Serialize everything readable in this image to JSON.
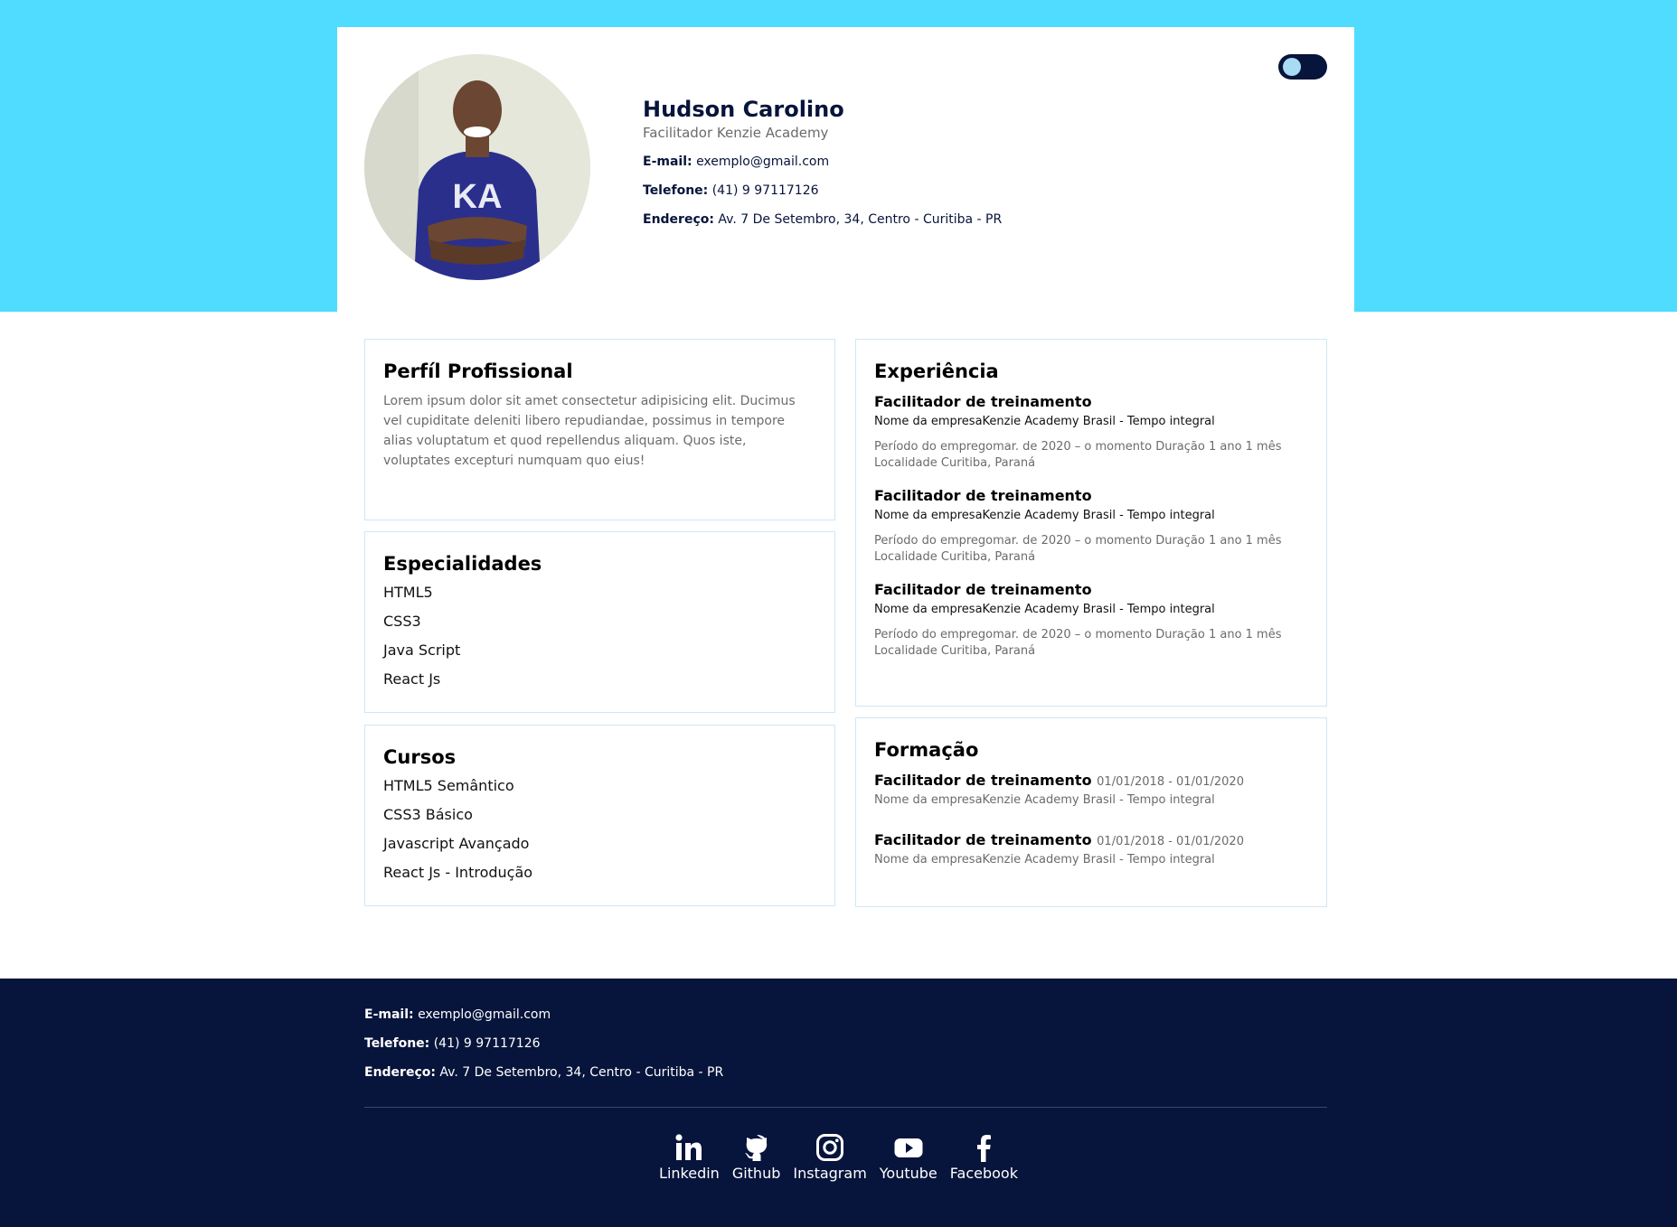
{
  "colors": {
    "hero": "#4fdcff",
    "navy": "#07143b",
    "border": "#cfe7f2"
  },
  "profile": {
    "name": "Hudson Carolino",
    "role": "Facilitador Kenzie Academy",
    "email_label": "E-mail:",
    "email": "exemplo@gmail.com",
    "phone_label": "Telefone:",
    "phone": "(41) 9 97117126",
    "address_label": "Endereço:",
    "address": "Av. 7 De Setembro, 34, Centro - Curitiba - PR",
    "shirt_logo": "KA"
  },
  "profile_section": {
    "title": "Perfíl Profissional",
    "text": "Lorem ipsum dolor sit amet consectetur adipisicing elit. Ducimus vel cupiditate deleniti libero repudiandae, possimus in tempore alias voluptatum et quod repellendus aliquam. Quos iste, voluptates excepturi numquam quo eius!"
  },
  "specialties": {
    "title": "Especialidades",
    "items": [
      "HTML5",
      "CSS3",
      "Java Script",
      "React Js"
    ]
  },
  "courses": {
    "title": "Cursos",
    "items": [
      "HTML5 Semântico",
      "CSS3 Básico",
      "Javascript Avançado",
      "React Js - Introdução"
    ]
  },
  "experience": {
    "title": "Experiência",
    "jobs": [
      {
        "title": "Facilitador de treinamento",
        "company": "Nome da empresaKenzie Academy Brasil - Tempo integral",
        "period": "Período do empregomar. de 2020 – o momento Duração 1 ano 1 mês",
        "location": "Localidade Curitiba, Paraná"
      },
      {
        "title": "Facilitador de treinamento",
        "company": "Nome da empresaKenzie Academy Brasil - Tempo integral",
        "period": "Período do empregomar. de 2020 – o momento Duração 1 ano 1 mês",
        "location": "Localidade Curitiba, Paraná"
      },
      {
        "title": "Facilitador de treinamento",
        "company": "Nome da empresaKenzie Academy Brasil - Tempo integral",
        "period": "Período do empregomar. de 2020 – o momento Duração 1 ano 1 mês",
        "location": "Localidade Curitiba, Paraná"
      }
    ]
  },
  "education": {
    "title": "Formação",
    "items": [
      {
        "title": "Facilitador de treinamento",
        "date": "01/01/2018 - 01/01/2020",
        "company": "Nome da empresaKenzie Academy Brasil - Tempo integral"
      },
      {
        "title": "Facilitador de treinamento",
        "date": "01/01/2018 - 01/01/2020",
        "company": "Nome da empresaKenzie Academy Brasil - Tempo integral"
      }
    ]
  },
  "footer": {
    "email_label": "E-mail:",
    "email": "exemplo@gmail.com",
    "phone_label": "Telefone:",
    "phone": "(41) 9 97117126",
    "address_label": "Endereço:",
    "address": "Av. 7 De Setembro, 34, Centro - Curitiba - PR",
    "socials": [
      {
        "label": "Linkedin",
        "icon": "linkedin-icon"
      },
      {
        "label": "Github",
        "icon": "github-icon"
      },
      {
        "label": "Instagram",
        "icon": "instagram-icon"
      },
      {
        "label": "Youtube",
        "icon": "youtube-icon"
      },
      {
        "label": "Facebook",
        "icon": "facebook-icon"
      }
    ]
  }
}
